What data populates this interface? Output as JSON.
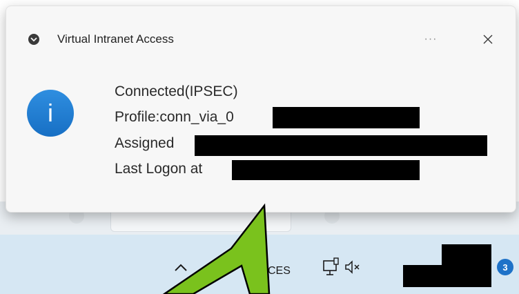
{
  "notification": {
    "app_title": "Virtual Intranet Access",
    "more_label": "···",
    "info_glyph": "i",
    "lines": [
      "Connected(IPSEC)",
      "Profile:conn_via_0",
      "Assigned",
      "Last Logon at"
    ]
  },
  "taskbar": {
    "language": "CES",
    "notification_count": "3"
  },
  "icons": {
    "app": "shield-check-icon",
    "more": "ellipsis-icon",
    "close": "close-icon",
    "info": "info-icon",
    "chevron": "chevron-up-icon",
    "network": "network-icon",
    "volume": "volume-muted-icon"
  },
  "colors": {
    "info_blue": "#1a73d0",
    "arrow_green": "#7ac21d",
    "redaction": "#000000",
    "taskbar": "#d6e7f3"
  }
}
